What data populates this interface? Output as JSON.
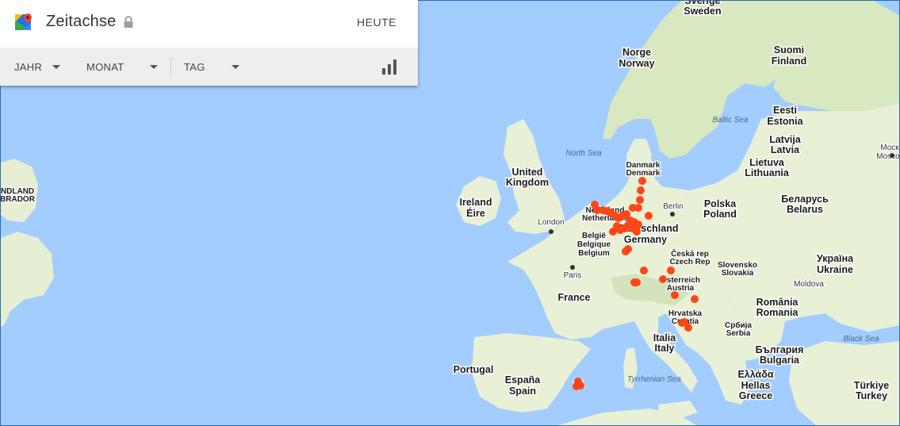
{
  "timeline": {
    "title": "Zeitachse",
    "today_label": "HEUTE",
    "filters": [
      {
        "label": "JAHR"
      },
      {
        "label": "MONAT"
      },
      {
        "label": "TAG"
      }
    ]
  },
  "map": {
    "colors": {
      "water": "#a3ccff",
      "land": "#e8f0d5",
      "forest": "#cfe3b2",
      "marker": "#ff4617"
    },
    "labels": {
      "sverige": "Sverige",
      "sweden": "Sweden",
      "norge": "Norge",
      "norway": "Norway",
      "suomi": "Suomi",
      "finland": "Finland",
      "eesti": "Eesti",
      "estonia": "Estonia",
      "latvija": "Latvija",
      "latvia": "Latvia",
      "lietuva": "Lietuva",
      "lithuania": "Lithuania",
      "baltic_sea": "Baltic Sea",
      "north_sea": "North Sea",
      "danmark": "Danmark",
      "denmark": "Denmark",
      "uk1": "United",
      "uk2": "Kingdom",
      "ireland": "Ireland",
      "eire": "Éire",
      "london": "London",
      "nederland": "Nederland",
      "netherlands": "Netherlands",
      "belgie": "België",
      "belgique": "Belgique",
      "belgium": "Belgium",
      "berlin": "Berlin",
      "deutschland": "Deutschland",
      "germany": "Germany",
      "polska": "Polska",
      "poland": "Poland",
      "belarus_native": "Беларусь",
      "belarus": "Belarus",
      "moscow": "Моск",
      "moscow2": "Mosco",
      "ceska": "Česká rep",
      "czech": "Czech Rep",
      "slovensko": "Slovensko",
      "slovakia": "Slovakia",
      "ukraina": "Україна",
      "ukraine": "Ukraine",
      "paris": "Paris",
      "france": "France",
      "osterreich": "Österreich",
      "austria": "Austria",
      "moldova": "Moldova",
      "romania_native": "România",
      "romania": "Romania",
      "hrvatska": "Hrvatska",
      "croatia": "Croatia",
      "srbija": "Србија",
      "serbia": "Serbia",
      "italia": "Italia",
      "italy": "Italy",
      "bulgaria_native": "България",
      "bulgaria": "Bulgaria",
      "black_sea": "Black Sea",
      "portugal": "Portugal",
      "espana": "España",
      "spain": "Spain",
      "tyrrhenian": "Tyrrhenian Sea",
      "hellas_native": "Ελλάδα",
      "hellas": "Hellas",
      "greece": "Greece",
      "turkiye": "Türkiye",
      "turkey": "Turkey",
      "nl_left1": "NDLAND",
      "nl_left2": "BRADOR"
    }
  }
}
